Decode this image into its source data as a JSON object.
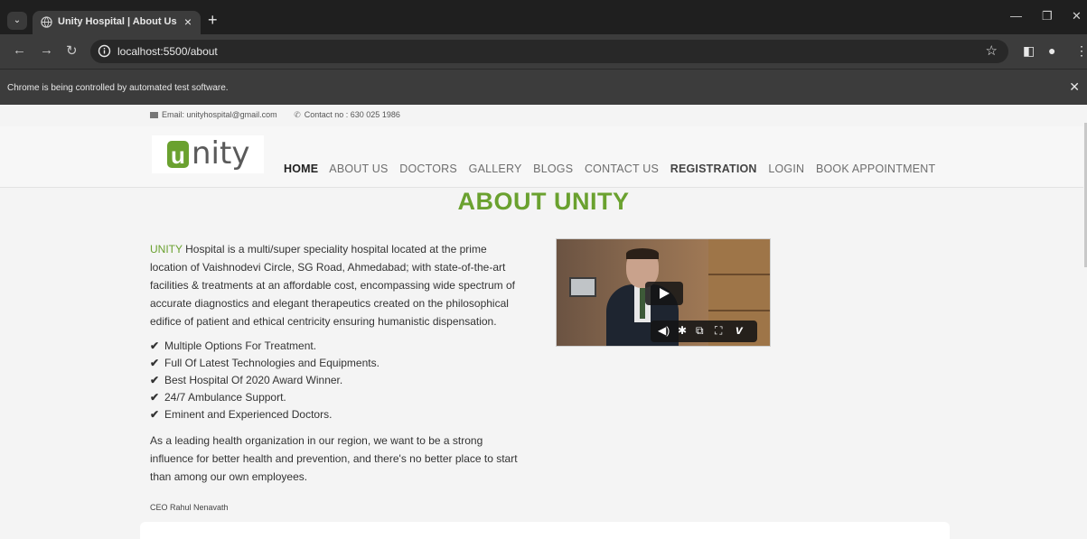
{
  "browser": {
    "tab_title": "Unity Hospital | About Us",
    "url": "localhost:5500/about",
    "infobar_message": "Chrome is being controlled by automated test software."
  },
  "topbar": {
    "email": "Email: unityhospital@gmail.com",
    "contact": "Contact no : 630 025 1986"
  },
  "logo": {
    "first_letter": "u",
    "rest": "nity"
  },
  "nav": {
    "items": [
      "HOME",
      "ABOUT US",
      "DOCTORS",
      "GALLERY",
      "BLOGS",
      "CONTACT US",
      "REGISTRATION",
      "LOGIN",
      "BOOK APPOINTMENT"
    ]
  },
  "about": {
    "title": "ABOUT UNITY",
    "brand": "UNITY",
    "intro": " Hospital is a multi/super speciality hospital located at the prime location of Vaishnodevi Circle, SG Road, Ahmedabad; with state-of-the-art facilities & treatments at an affordable cost, encompassing wide spectrum of accurate diagnostics and elegant therapeutics created on the philosophical edifice of patient and ethical centricity ensuring humanistic dispensation.",
    "features": [
      "Multiple Options For Treatment.",
      "Full Of Latest Technologies and Equipments.",
      "Best Hospital Of 2020 Award Winner.",
      "24/7 Ambulance Support.",
      "Eminent and Experienced Doctors."
    ],
    "closing": "As a leading health organization in our region, we want to be a strong influence for better health and prevention, and there's no better place to start than among our own employees.",
    "ceo": "CEO Rahul Nenavath"
  }
}
